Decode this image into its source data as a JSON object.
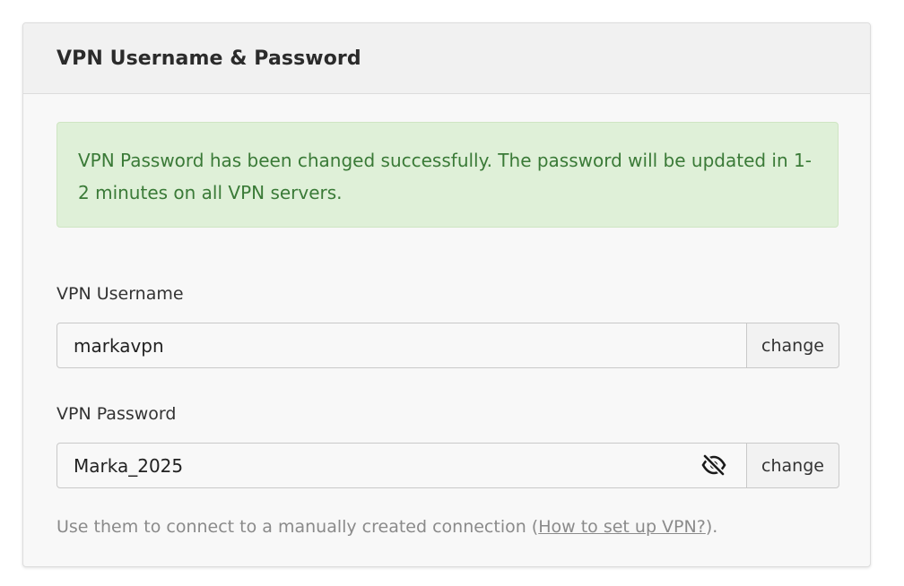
{
  "panel": {
    "title": "VPN Username & Password"
  },
  "alert": {
    "message": "VPN Password has been changed successfully. The password will be updated in 1-2 minutes on all VPN servers."
  },
  "username": {
    "label": "VPN Username",
    "value": "markavpn",
    "button_label": "change"
  },
  "password": {
    "label": "VPN Password",
    "value": "Marka_2025",
    "visibility_icon": "eye-slash-icon",
    "button_label": "change"
  },
  "help": {
    "text_before": "Use them to connect to a manually created connection (",
    "link_text": "How to set up VPN?",
    "text_after": ")."
  },
  "colors": {
    "alert_bg": "#dff0d8",
    "alert_text": "#3a7a37",
    "panel_bg": "#f8f8f8"
  }
}
